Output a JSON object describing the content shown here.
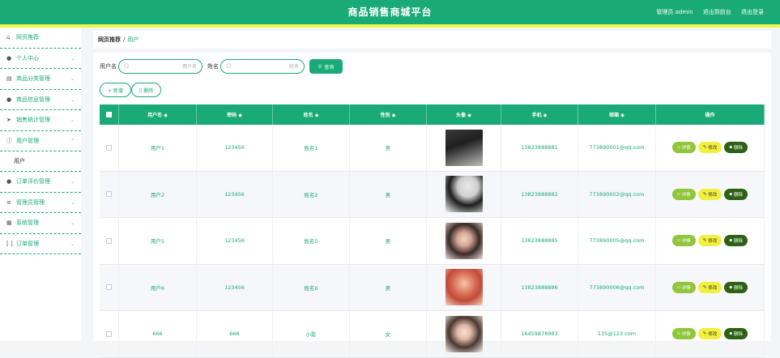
{
  "header": {
    "title": "商品销售商城平台",
    "admin_label": "管理员 admin",
    "to_front": "退出到前台",
    "logout": "退出登录"
  },
  "sidebar": {
    "items": [
      {
        "label": "网页推荐",
        "icon": "home-icon"
      },
      {
        "label": "个人中心",
        "icon": "user-icon"
      },
      {
        "label": "商品分类管理",
        "icon": "list-icon"
      },
      {
        "label": "商品信息管理",
        "icon": "user-icon"
      },
      {
        "label": "销售统计管理",
        "icon": "send-icon"
      },
      {
        "label": "用户管理",
        "icon": "info-icon",
        "sub": [
          "用户"
        ]
      },
      {
        "label": "订单评价管理",
        "icon": "user-icon"
      },
      {
        "label": "管理员管理",
        "icon": "menu-icon"
      },
      {
        "label": "系统管理",
        "icon": "doc-icon"
      },
      {
        "label": "订单管理",
        "icon": "bracket-icon"
      }
    ]
  },
  "breadcrumb": {
    "home": "网页推荐",
    "sep": "/",
    "current": "用户"
  },
  "search": {
    "username_label": "用户名",
    "username_placeholder": "用户名",
    "name_label": "姓名",
    "name_placeholder": "姓名",
    "query_button": "查询"
  },
  "actions": {
    "add": "+ 新增",
    "delete": "删除"
  },
  "table": {
    "columns": [
      "用户名 ◆",
      "密码 ◆",
      "姓名 ◆",
      "性别 ◆",
      "头像 ◆",
      "手机 ◆",
      "邮箱 ◆",
      "操作"
    ],
    "rows": [
      {
        "username": "用户1",
        "password": "123456",
        "name": "姓名1",
        "gender": "男",
        "phone": "13823888881",
        "email": "773890001@qq.com"
      },
      {
        "username": "用户2",
        "password": "123456",
        "name": "姓名2",
        "gender": "男",
        "phone": "13823888882",
        "email": "773890002@qq.com"
      },
      {
        "username": "用户5",
        "password": "123456",
        "name": "姓名5",
        "gender": "男",
        "phone": "13823888885",
        "email": "773890005@qq.com"
      },
      {
        "username": "用户6",
        "password": "123456",
        "name": "姓名6",
        "gender": "男",
        "phone": "13823888886",
        "email": "773890006@qq.com"
      },
      {
        "username": "666",
        "password": "666",
        "name": "小影",
        "gender": "女",
        "phone": "16459878983",
        "email": "135@123.com"
      }
    ],
    "op_detail": "详情",
    "op_edit": "修改",
    "op_delete": "删除"
  },
  "colors": {
    "primary": "#1aaa78",
    "accent_yellow": "#e9f84a",
    "detail_btn": "#8fc63c",
    "edit_btn": "#f2f03e",
    "delete_btn": "#2d6115"
  }
}
